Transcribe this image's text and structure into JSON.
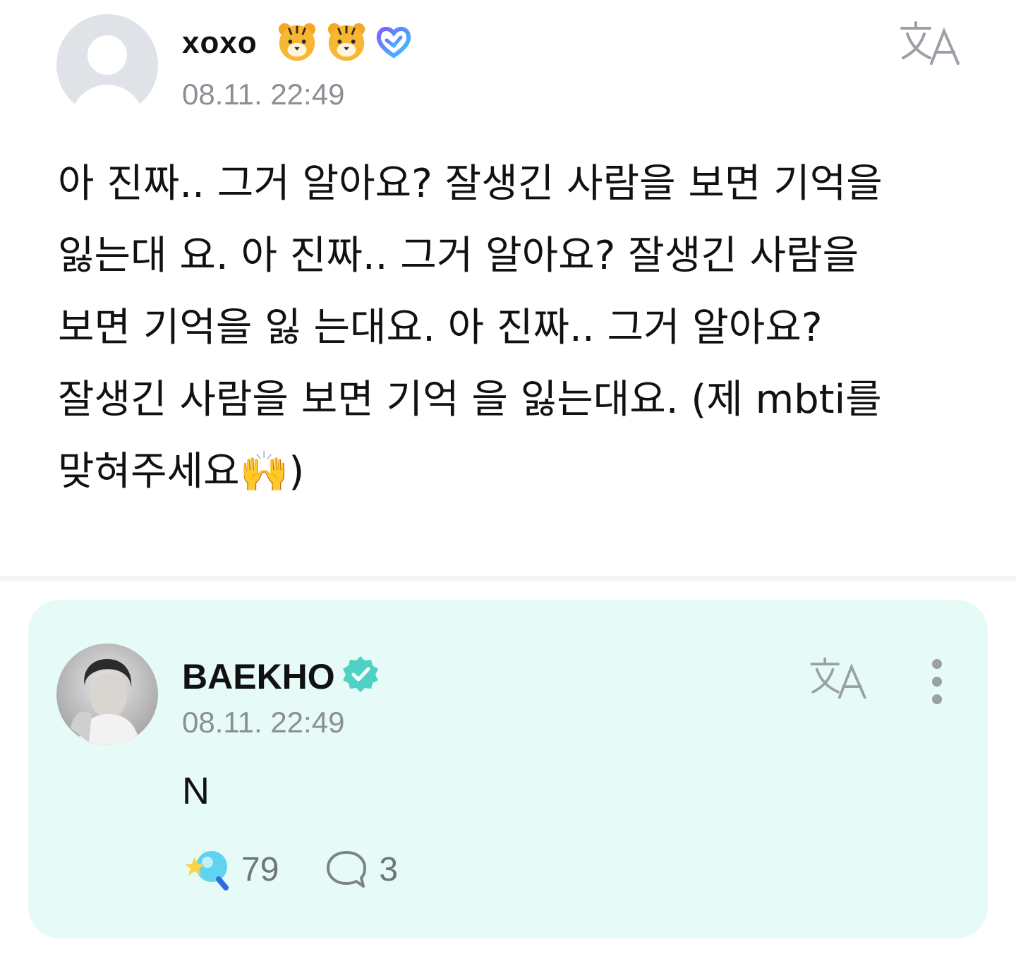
{
  "post": {
    "author": "xoxo",
    "timestamp": "08.11. 22:49",
    "body": "아 진짜.. 그거 알아요? 잘생긴 사람을 보면 기억을\n잃는대 요. 아 진짜.. 그거 알아요? 잘생긴 사람을\n보면 기억을 잃 는대요. 아 진짜.. 그거 알아요?\n잘생긴 사람을 보면 기억 을 잃는대요. (제 mbti를\n맞혀주세요🙌)",
    "badges": [
      "tiger-face-icon",
      "tiger-face-icon",
      "heart-membership-icon"
    ]
  },
  "reply": {
    "author": "BAEKHO",
    "timestamp": "08.11. 22:49",
    "body": "N",
    "like_count": "79",
    "comment_count": "3"
  },
  "colors": {
    "reply_background": "#e6fbf7",
    "verified": "#4fd1c5",
    "muted": "#8a8f96"
  }
}
